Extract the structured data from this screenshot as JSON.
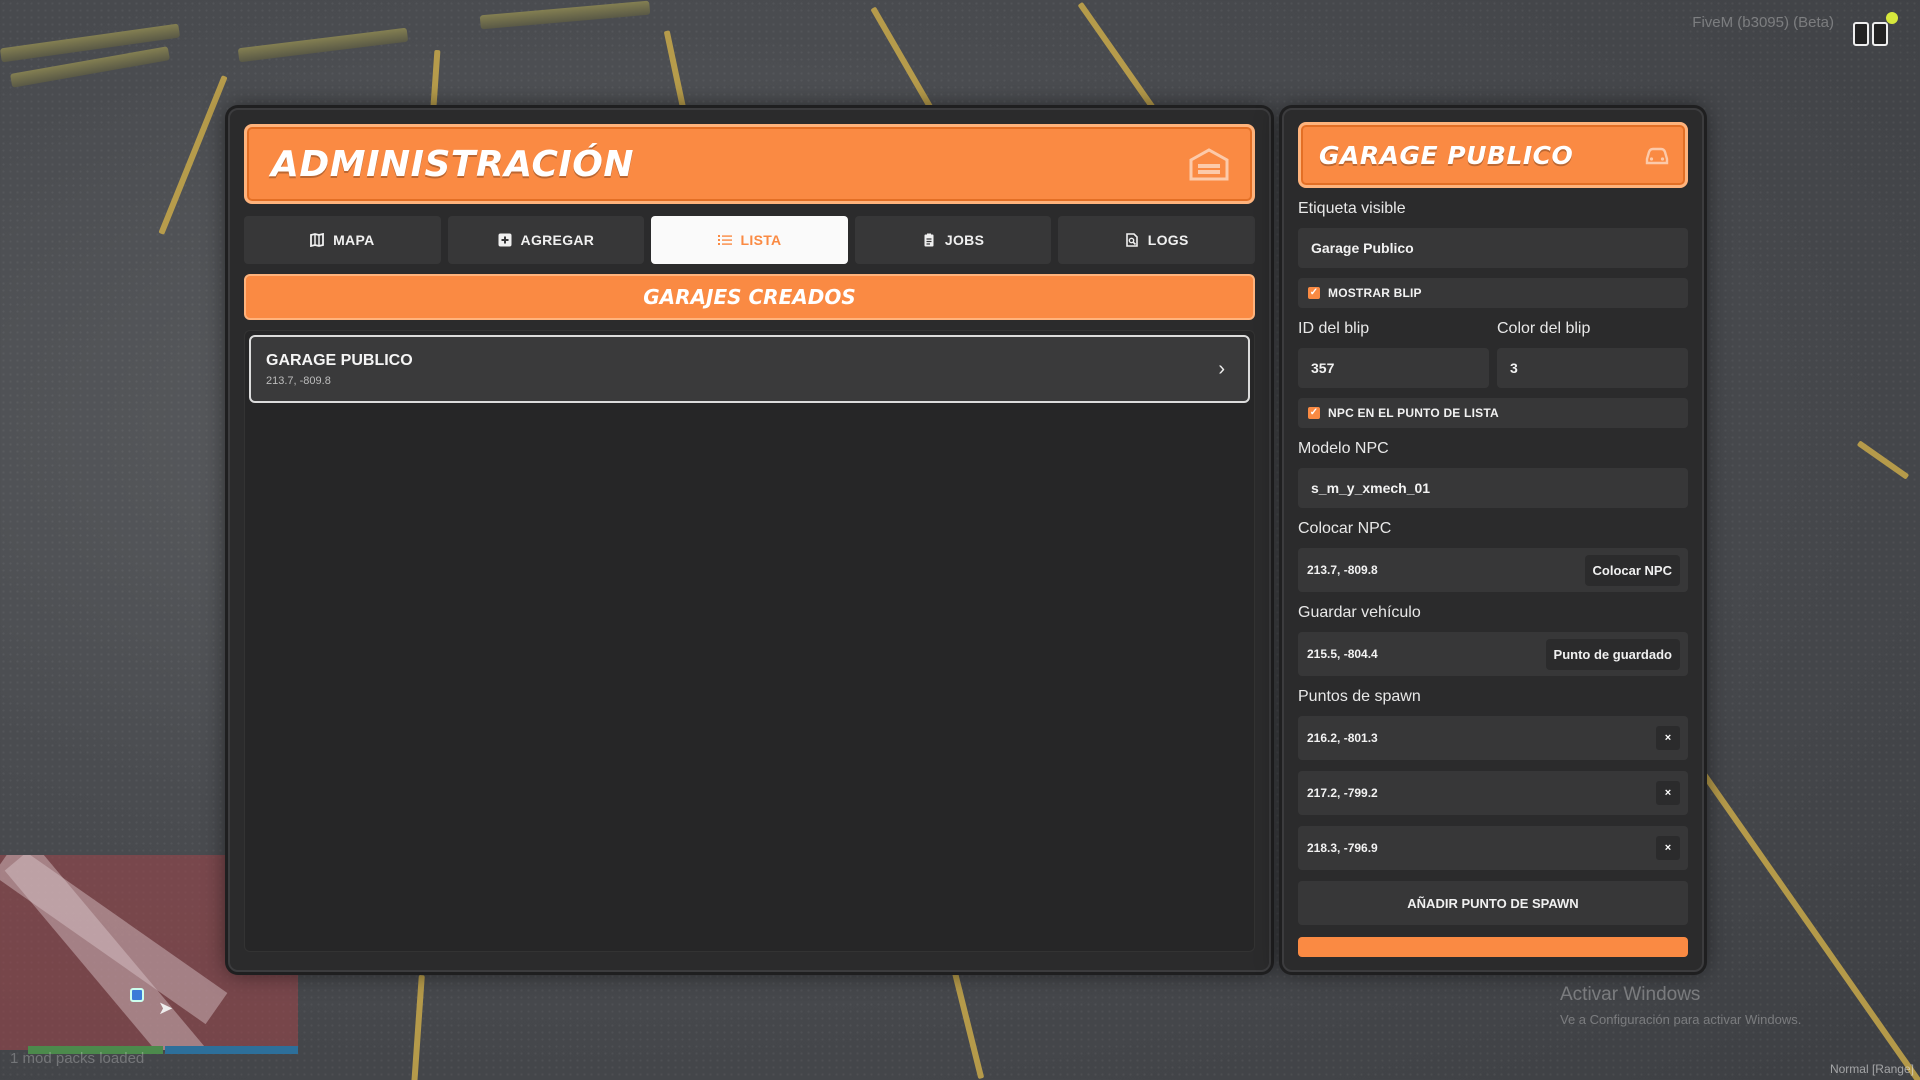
{
  "hud": {
    "fivem_label": "FiveM (b3095) (Beta)",
    "mod_packs": "1 mod packs loaded",
    "watermark_title": "Activar Windows",
    "watermark_sub": "Ve a Configuración para activar Windows.",
    "mode_tag": "Normal [Range]"
  },
  "admin": {
    "title": "ADMINISTRACIÓN",
    "header_icon": "garage-icon",
    "tabs": [
      {
        "label": "MAPA",
        "icon": "map-icon"
      },
      {
        "label": "AGREGAR",
        "icon": "plus-square-icon"
      },
      {
        "label": "LISTA",
        "icon": "list-icon",
        "active": true
      },
      {
        "label": "JOBS",
        "icon": "clipboard-icon"
      },
      {
        "label": "LOGS",
        "icon": "file-search-icon"
      }
    ],
    "section_title": "GARAJES CREADOS",
    "garages": [
      {
        "name": "GARAGE PUBLICO",
        "coords": "213.7, -809.8"
      }
    ]
  },
  "garage": {
    "title": "GARAGE PUBLICO",
    "header_icon": "car-icon",
    "visible_label": "Etiqueta visible",
    "visible_value": "Garage Publico",
    "show_blip_label": "MOSTRAR BLIP",
    "show_blip_checked": true,
    "blip_id_label": "ID del blip",
    "blip_id_value": "357",
    "blip_color_label": "Color del blip",
    "blip_color_value": "3",
    "npc_point_label": "NPC EN EL PUNTO DE LISTA",
    "npc_point_checked": true,
    "npc_model_label": "Modelo NPC",
    "npc_model_value": "s_m_y_xmech_01",
    "place_npc_label": "Colocar NPC",
    "place_npc_value": "213.7, -809.8",
    "place_npc_button": "Colocar NPC",
    "store_vehicle_label": "Guardar vehículo",
    "store_vehicle_value": "215.5, -804.4",
    "store_vehicle_button": "Punto de guardado",
    "spawn_label": "Puntos de spawn",
    "spawn_points": [
      "216.2, -801.3",
      "217.2, -799.2",
      "218.3, -796.9"
    ],
    "remove_label": "×",
    "add_spawn_button": "AÑADIR PUNTO DE SPAWN"
  },
  "colors": {
    "accent": "#fa8a43",
    "panel": "#2b2b2c",
    "field": "#373738"
  }
}
